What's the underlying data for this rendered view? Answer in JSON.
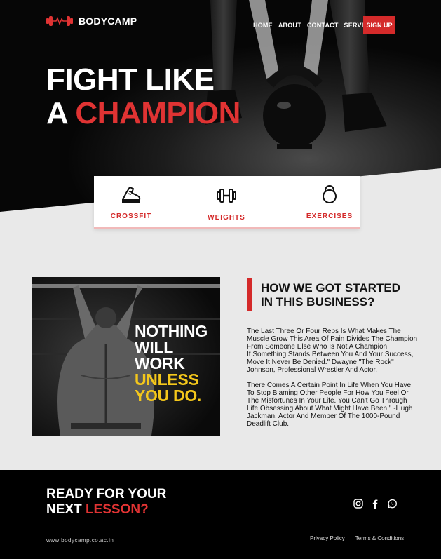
{
  "brand": {
    "name": "BODYCAMP",
    "logo_icon": "dumbbell-heartbeat-icon",
    "accent": "#d42a2a"
  },
  "nav": {
    "items": [
      "HOME",
      "ABOUT",
      "CONTACT",
      "SERVICES"
    ],
    "signup": "SIGN UP"
  },
  "hero": {
    "line1": "FIGHT LIKE",
    "line2_prefix": "A ",
    "line2_highlight": "CHAMPION"
  },
  "services": [
    {
      "label": "CROSSFIT",
      "icon": "sneaker-icon"
    },
    {
      "label": "WEIGHTS",
      "icon": "dumbbell-icon"
    },
    {
      "label": "EXERCISES",
      "icon": "kettlebell-icon"
    }
  ],
  "poster": {
    "line1": "NOTHING",
    "line2": "WILL",
    "line3": "WORK",
    "line4": "UNLESS",
    "line5": "YOU DO."
  },
  "story": {
    "title_line1": "HOW WE GOT STARTED",
    "title_line2": "IN THIS BUSINESS?",
    "para1": "The Last Three Or Four Reps Is What Makes The\nMuscle Grow This Area Of Pain Divides The Champion\nFrom Someone Else Who Is Not A Champion.\nIf Something Stands Between You And Your Success,\nMove It Never Be Denied.\" Dwayne \"The Rock\"\nJohnson, Professional Wrestler And Actor.",
    "para2": "There Comes A Certain Point In Life When You Have\nTo Stop Blaming Other People For How You Feel Or\nThe Misfortunes In Your Life. You Can't Go Through\nLife Obsessing About What Might Have Been.\" -Hugh\nJackman, Actor And  Member Of The 1000-Pound\nDeadlift Club."
  },
  "footer": {
    "cta_line1": "READY FOR YOUR",
    "cta_line2_prefix": "NEXT ",
    "cta_line2_highlight": "LESSON?",
    "social": [
      "instagram-icon",
      "facebook-icon",
      "whatsapp-icon"
    ],
    "site": "www.bodycamp.co.ac.in",
    "privacy": "Privacy Policy",
    "terms": "Terms & Conditions"
  }
}
